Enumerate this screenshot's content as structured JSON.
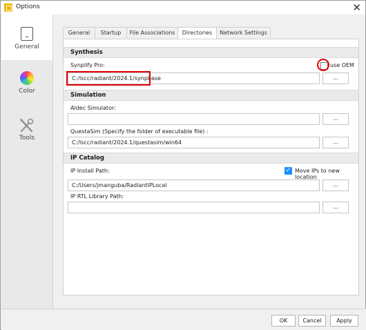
{
  "window": {
    "title": "Options",
    "close_glyph": "✕"
  },
  "sidebar": {
    "items": [
      {
        "label": "General",
        "icon": "general-icon"
      },
      {
        "label": "Color",
        "icon": "color-wheel-icon"
      },
      {
        "label": "Tools",
        "icon": "tools-icon"
      }
    ]
  },
  "tabs": [
    "General",
    "Startup",
    "File Associations",
    "Directories",
    "Network Settings"
  ],
  "active_tab": "Directories",
  "synthesis": {
    "header": "Synthesis",
    "synplify_label": "Synplify Pro:",
    "synplify_value": "C:/lscc/radiant/2024.1/synpbase",
    "use_oem_label": "use OEM",
    "use_oem_checked": false
  },
  "simulation": {
    "header": "Simulation",
    "aldec_label": "Aldec Simulator:",
    "aldec_value": "",
    "questa_label": "QuestaSim (Specify the folder of executable file) :",
    "questa_value": "C:/lscc/radiant/2024.1/questasim/win64"
  },
  "ip_catalog": {
    "header": "IP Catalog",
    "install_label": "IP Install Path:",
    "move_label": "Move IPs to new location",
    "move_checked": true,
    "install_value": "C:/Users/jmanguba/RadiantIPLocal",
    "rtl_label": "IP RTL Library Path:",
    "rtl_value": ""
  },
  "browse_label": "...",
  "buttons": {
    "ok": "OK",
    "cancel": "Cancel",
    "apply": "Apply"
  },
  "colors": {
    "highlight": "#e00000",
    "checkbox_blue": "#1e90ff",
    "app_icon": "#f2b705"
  }
}
